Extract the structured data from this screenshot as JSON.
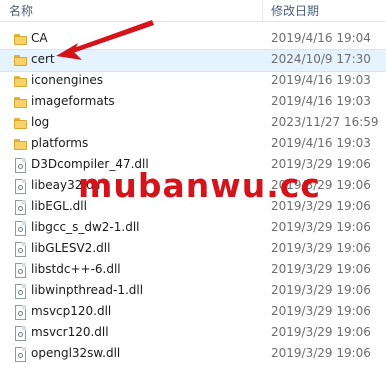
{
  "header": {
    "name_label": "名称",
    "date_label": "修改日期"
  },
  "files": [
    {
      "name": "CA",
      "date": "2019/4/16 19:04",
      "type": "folder"
    },
    {
      "name": "cert",
      "date": "2024/10/9 17:30",
      "type": "folder",
      "selected": true
    },
    {
      "name": "iconengines",
      "date": "2019/4/16 19:03",
      "type": "folder"
    },
    {
      "name": "imageformats",
      "date": "2019/4/16 19:03",
      "type": "folder"
    },
    {
      "name": "log",
      "date": "2023/11/27 16:59",
      "type": "folder"
    },
    {
      "name": "platforms",
      "date": "2019/4/16 19:03",
      "type": "folder"
    },
    {
      "name": "D3Dcompiler_47.dll",
      "date": "2019/3/29 19:06",
      "type": "dll"
    },
    {
      "name": "libeay32.dll",
      "date": "2019/3/29 19:06",
      "type": "dll"
    },
    {
      "name": "libEGL.dll",
      "date": "2019/3/29 19:06",
      "type": "dll"
    },
    {
      "name": "libgcc_s_dw2-1.dll",
      "date": "2019/3/29 19:06",
      "type": "dll"
    },
    {
      "name": "libGLESV2.dll",
      "date": "2019/3/29 19:06",
      "type": "dll"
    },
    {
      "name": "libstdc++-6.dll",
      "date": "2019/3/29 19:06",
      "type": "dll"
    },
    {
      "name": "libwinpthread-1.dll",
      "date": "2019/3/29 19:06",
      "type": "dll"
    },
    {
      "name": "msvcp120.dll",
      "date": "2019/3/29 19:06",
      "type": "dll"
    },
    {
      "name": "msvcr120.dll",
      "date": "2019/3/29 19:06",
      "type": "dll"
    },
    {
      "name": "opengl32sw.dll",
      "date": "2019/3/29 19:06",
      "type": "dll"
    }
  ],
  "watermark": {
    "text": "mubanwu.cc",
    "color": "#d4131b"
  },
  "colors": {
    "selection": "#e5f3ff",
    "folder": "#f7d26a",
    "arrow": "#d4131b"
  }
}
